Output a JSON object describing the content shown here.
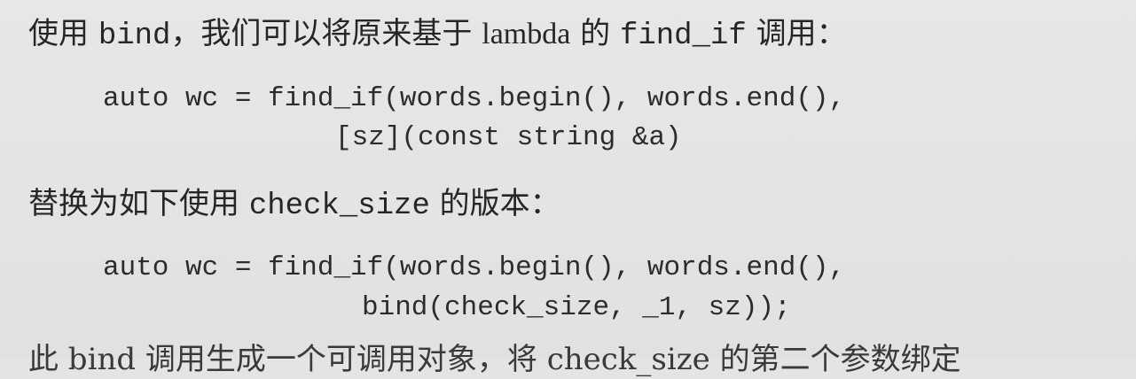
{
  "paragraph1": {
    "part1": "使用 ",
    "part2": "bind",
    "part3": "，我们可以将原来基于 ",
    "part4": "lambda",
    "part5": " 的 ",
    "part6": "find_if",
    "part7": " 调用："
  },
  "code1": {
    "line1": "auto wc = find_if(words.begin(), words.end(),",
    "line2": "[sz](const string &a)"
  },
  "paragraph2": {
    "part1": "替换为如下使用 ",
    "part2": "check_size",
    "part3": " 的版本："
  },
  "code2": {
    "line1": "auto wc = find_if(words.begin(), words.end(),",
    "line2": "bind(check_size, _1, sz));"
  },
  "paragraph3_partial": {
    "text": "此 bind 调用生成一个可调用对象，将 check_size 的第二个参数绑定"
  }
}
